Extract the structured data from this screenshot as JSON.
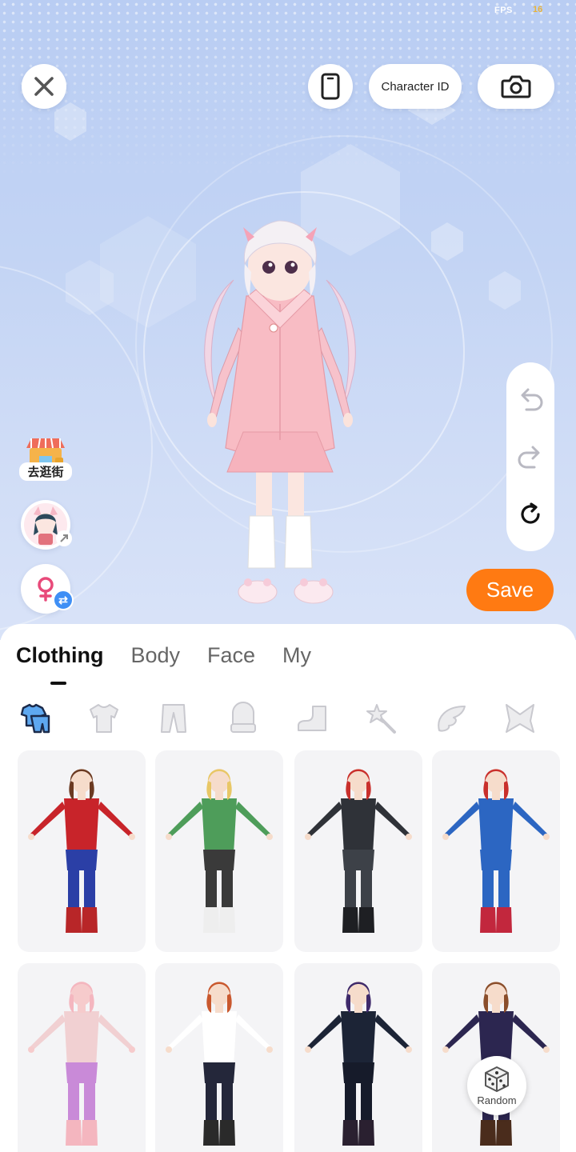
{
  "status": {
    "fps_label": "FPS",
    "fps_value": "16"
  },
  "toolbar": {
    "close_icon": "close-icon",
    "device_icon": "phone-icon",
    "character_id_label": "Character ID",
    "camera_icon": "camera-icon"
  },
  "side": {
    "shop_label": "去逛街"
  },
  "history": {
    "undo_icon": "undo-icon",
    "redo_icon": "redo-icon",
    "reset_icon": "reset-icon"
  },
  "save_label": "Save",
  "tabs": [
    {
      "label": "Clothing",
      "active": true
    },
    {
      "label": "Body",
      "active": false
    },
    {
      "label": "Face",
      "active": false
    },
    {
      "label": "My",
      "active": false
    }
  ],
  "categories": [
    {
      "icon": "outfit-set-icon",
      "active": true
    },
    {
      "icon": "top-icon",
      "active": false
    },
    {
      "icon": "pants-icon",
      "active": false
    },
    {
      "icon": "gloves-icon",
      "active": false
    },
    {
      "icon": "shoes-icon",
      "active": false
    },
    {
      "icon": "magic-wand-icon",
      "active": false
    },
    {
      "icon": "wings-icon",
      "active": false
    },
    {
      "icon": "bow-icon",
      "active": false
    }
  ],
  "outfits": [
    {
      "name": "outfit-wonder-hero",
      "hair": "#6b3a22",
      "top": "#c8242a",
      "bottom": "#2b3fa6",
      "boots": "#b82628",
      "skin": "#f6dccb"
    },
    {
      "name": "outfit-green-kimono",
      "hair": "#e8c766",
      "top": "#4e9d5a",
      "bottom": "#3a3a3a",
      "boots": "#eeeeee",
      "skin": "#f6dccb"
    },
    {
      "name": "outfit-black-bodysuit",
      "hair": "#c9302c",
      "top": "#2f3238",
      "bottom": "#3d4148",
      "boots": "#1e1f23",
      "skin": "#f6dccb"
    },
    {
      "name": "outfit-captain-hero",
      "hair": "#c9302c",
      "top": "#2c66c2",
      "bottom": "#2c66c2",
      "boots": "#c2273d",
      "skin": "#f6dccb"
    },
    {
      "name": "outfit-pink-cat",
      "hair": "#f4b6bf",
      "top": "#f1d0d2",
      "bottom": "#c98ad8",
      "boots": "#f4b6bf",
      "skin": "#f6cbcc"
    },
    {
      "name": "outfit-sport-tee",
      "hair": "#c9582e",
      "top": "#ffffff",
      "bottom": "#24273a",
      "boots": "#2a2a2a",
      "skin": "#f6dccb"
    },
    {
      "name": "outfit-gothic-dress",
      "hair": "#3f2a6b",
      "top": "#1c2436",
      "bottom": "#161b2a",
      "boots": "#2a2030",
      "skin": "#f6dccb"
    },
    {
      "name": "outfit-school-robe",
      "hair": "#8a4e2b",
      "top": "#2c2650",
      "bottom": "#2c2650",
      "boots": "#4a2c1c",
      "skin": "#f6dccb"
    }
  ],
  "random_label": "Random",
  "colors": {
    "accent": "#ff7a12",
    "badge_blue": "#3f8ff5"
  }
}
